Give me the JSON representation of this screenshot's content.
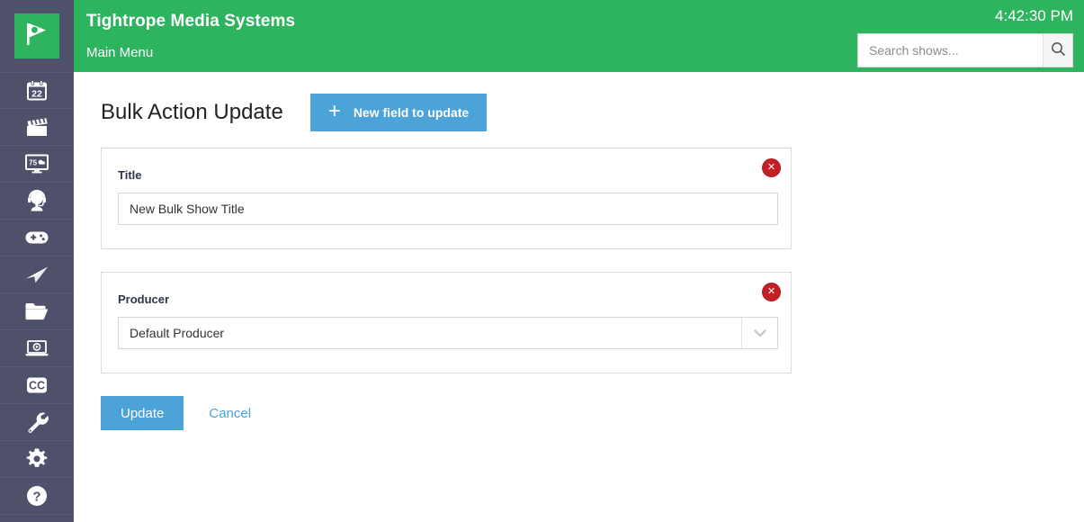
{
  "brand": {
    "title": "Tightrope Media Systems",
    "main_menu": "Main Menu",
    "logo_icon": "flag-play-logo-icon",
    "logo_bg": "#2eb35f"
  },
  "header": {
    "clock": "4:42:30 PM",
    "accent_color": "#2eb35f"
  },
  "search": {
    "placeholder": "Search shows...",
    "value": "",
    "button_icon": "search-icon"
  },
  "sidebar": {
    "background": "#4f506a",
    "items": [
      {
        "name": "calendar",
        "icon": "calendar-22-icon",
        "label": "Calendar"
      },
      {
        "name": "clapboard",
        "icon": "clapboard-icon",
        "label": "Shows"
      },
      {
        "name": "channel",
        "icon": "tv-75-icon",
        "label": "Channels"
      },
      {
        "name": "talent",
        "icon": "headset-person-icon",
        "label": "Talent"
      },
      {
        "name": "controller",
        "icon": "game-controller-icon",
        "label": "Control"
      },
      {
        "name": "send",
        "icon": "paper-plane-icon",
        "label": "Publish"
      },
      {
        "name": "files",
        "icon": "folder-icon",
        "label": "Files"
      },
      {
        "name": "player",
        "icon": "laptop-play-icon",
        "label": "Player"
      },
      {
        "name": "captions",
        "icon": "cc-icon",
        "label": "Captions"
      },
      {
        "name": "tools",
        "icon": "wrench-icon",
        "label": "Tools"
      },
      {
        "name": "settings",
        "icon": "gear-icon",
        "label": "Settings"
      },
      {
        "name": "help",
        "icon": "question-circle-icon",
        "label": "Help"
      }
    ]
  },
  "main": {
    "page_title": "Bulk Action Update",
    "new_field_button": {
      "label": "New field to update",
      "icon": "plus-icon",
      "color": "#4ba3d8"
    },
    "fields": [
      {
        "label": "Title",
        "type": "text",
        "value": "New Bulk Show Title",
        "remove_icon": "close-x-icon"
      },
      {
        "label": "Producer",
        "type": "select",
        "value": "Default Producer",
        "remove_icon": "close-x-icon",
        "chevron_icon": "chevron-down-icon"
      }
    ],
    "actions": {
      "update_label": "Update",
      "cancel_label": "Cancel",
      "primary_color": "#4ba3d8"
    }
  }
}
